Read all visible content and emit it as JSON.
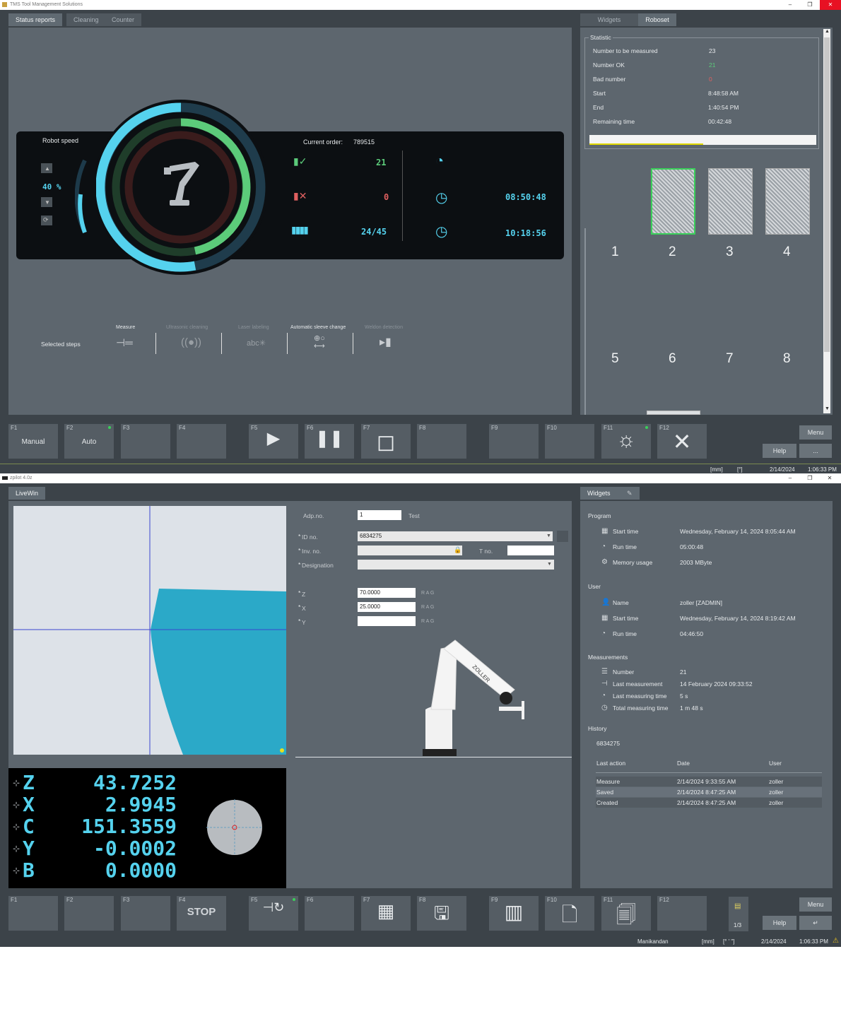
{
  "top": {
    "title": "TMS Tool Management Solutions",
    "tabs_left": [
      "Status reports",
      "Cleaning",
      "Counter"
    ],
    "tabs_right": [
      "Widgets",
      "Roboset"
    ],
    "robot_speed_label": "Robot speed",
    "robot_speed_value": "40 %",
    "current_order_label": "Current order:",
    "current_order_value": "789515",
    "ok_count": "21",
    "bad_count": "0",
    "progress_count": "24/45",
    "time_1": "08:50:48",
    "time_2": "10:18:56",
    "selected_steps_label": "Selected steps",
    "steps": [
      "Measure",
      "Ultrasonic cleaning",
      "Laser labeling",
      "Automatic sleeve change",
      "Weldon detection"
    ],
    "statistic": {
      "title": "Statistic",
      "rows": [
        {
          "label": "Number to be measured",
          "value": "23"
        },
        {
          "label": "Number OK",
          "value": "21"
        },
        {
          "label": "Bad number",
          "value": "0"
        },
        {
          "label": "Start",
          "value": "8:48:58 AM"
        },
        {
          "label": "End",
          "value": "1:40:54 PM"
        },
        {
          "label": "Remaining time",
          "value": "00:42:48"
        }
      ],
      "progress": 0.5
    },
    "pallets": [
      "1",
      "2",
      "3",
      "4",
      "5",
      "6",
      "7",
      "8"
    ],
    "fkeys": [
      {
        "key": "F1",
        "label": "Manual"
      },
      {
        "key": "F2",
        "label": "Auto"
      },
      {
        "key": "F3",
        "label": ""
      },
      {
        "key": "F4",
        "label": ""
      },
      {
        "key": "F5",
        "label": ""
      },
      {
        "key": "F6",
        "label": ""
      },
      {
        "key": "F7",
        "label": ""
      },
      {
        "key": "F8",
        "label": ""
      },
      {
        "key": "F9",
        "label": ""
      },
      {
        "key": "F10",
        "label": ""
      },
      {
        "key": "F11",
        "label": ""
      },
      {
        "key": "F12",
        "label": ""
      }
    ],
    "menu_label": "Menu",
    "help_label": "Help",
    "more_label": "...",
    "status": {
      "unit1": "[mm]",
      "unit2": "[°]",
      "date": "2/14/2024",
      "time": "1:06:33 PM"
    }
  },
  "bottom": {
    "title": "zpilot 4.0z",
    "tab_left": "LiveWin",
    "tab_right": "Widgets",
    "form": {
      "adp_label": "Adp.no.",
      "adp_value": "1",
      "test_label": "Test",
      "id_label": "ID no.",
      "id_value": "6834275",
      "inv_label": "Inv. no.",
      "t_label": "T no.",
      "designation_label": "Designation",
      "z_label": "Z",
      "z_value": "70.0000",
      "x_label": "X",
      "x_value": "25.0000",
      "y_label": "Y",
      "rag": "R A G"
    },
    "robot_brand": "ZOLLER",
    "dro": [
      {
        "axis": "Z",
        "value": "43.7252"
      },
      {
        "axis": "X",
        "value": "2.9945"
      },
      {
        "axis": "C",
        "value": "151.3559"
      },
      {
        "axis": "Y",
        "value": "-0.0002"
      },
      {
        "axis": "B",
        "value": "0.0000"
      }
    ],
    "widgets": {
      "program_title": "Program",
      "program": [
        {
          "label": "Start time",
          "value": "Wednesday, February 14, 2024 8:05:44 AM"
        },
        {
          "label": "Run time",
          "value": "05:00:48"
        },
        {
          "label": "Memory usage",
          "value": "2003 MByte"
        }
      ],
      "user_title": "User",
      "user": [
        {
          "label": "Name",
          "value": "zoller [ZADMIN]"
        },
        {
          "label": "Start time",
          "value": "Wednesday, February 14, 2024 8:19:42 AM"
        },
        {
          "label": "Run time",
          "value": "04:46:50"
        }
      ],
      "meas_title": "Measurements",
      "meas": [
        {
          "label": "Number",
          "value": "21"
        },
        {
          "label": "Last measurement",
          "value": "14 February 2024 09:33:52"
        },
        {
          "label": "Last measuring time",
          "value": "5 s"
        },
        {
          "label": "Total measuring time",
          "value": "1 m 48 s"
        }
      ],
      "history_title": "History",
      "history_id": "6834275",
      "history_headers": [
        "Last action",
        "Date",
        "User"
      ],
      "history_rows": [
        {
          "action": "Measure",
          "date": "2/14/2024 9:33:55 AM",
          "user": "zoller"
        },
        {
          "action": "Saved",
          "date": "2/14/2024 8:47:25 AM",
          "user": "zoller"
        },
        {
          "action": "Created",
          "date": "2/14/2024 8:47:25 AM",
          "user": "zoller"
        }
      ]
    },
    "fkeys": [
      {
        "key": "F1",
        "label": ""
      },
      {
        "key": "F2",
        "label": ""
      },
      {
        "key": "F3",
        "label": ""
      },
      {
        "key": "F4",
        "label": "STOP"
      },
      {
        "key": "F5",
        "label": ""
      },
      {
        "key": "F6",
        "label": ""
      },
      {
        "key": "F7",
        "label": ""
      },
      {
        "key": "F8",
        "label": ""
      },
      {
        "key": "F9",
        "label": ""
      },
      {
        "key": "F10",
        "label": ""
      },
      {
        "key": "F11",
        "label": ""
      },
      {
        "key": "F12",
        "label": ""
      }
    ],
    "page_indicator": "1/3",
    "menu_label": "Menu",
    "help_label": "Help",
    "status": {
      "user": "Manikandan",
      "unit1": "[mm]",
      "unit2": "[° ' \"]",
      "date": "2/14/2024",
      "time": "1:06:33 PM"
    }
  }
}
